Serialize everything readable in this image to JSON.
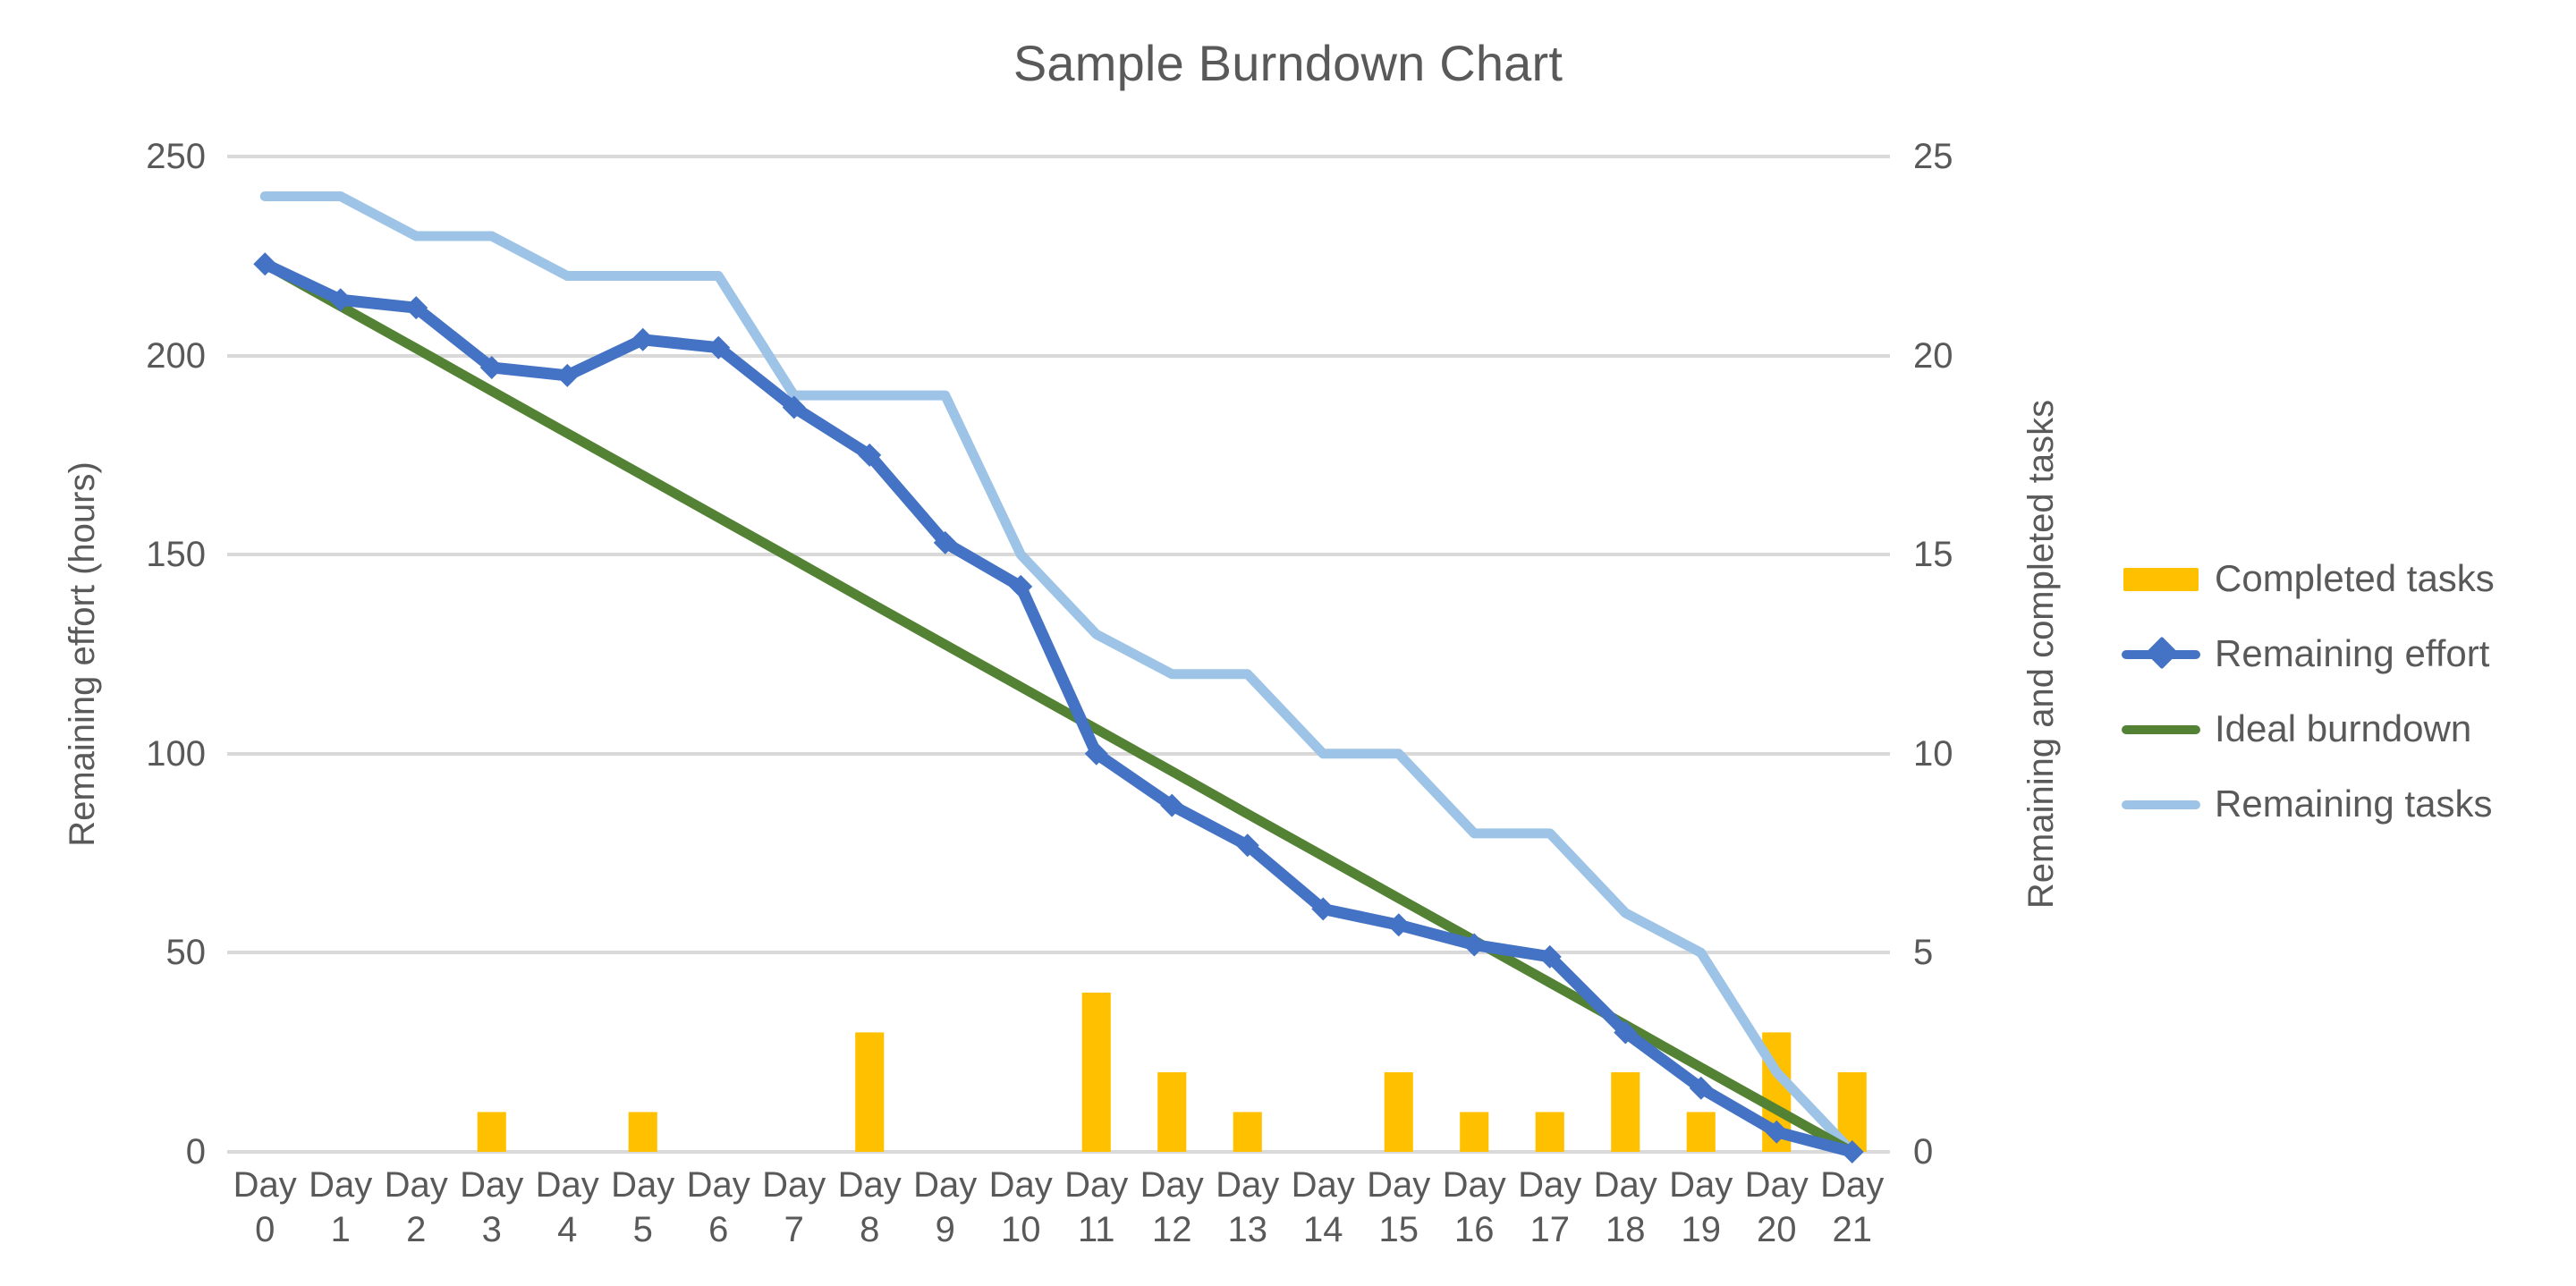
{
  "chart": {
    "title": "Sample Burndown Chart",
    "background_color": "#ffffff",
    "text_color": "#595959",
    "gridline_color": "#d9d9d9"
  },
  "axes": {
    "left": {
      "title": "Remaining effort (hours)",
      "ticks": [
        "0",
        "50",
        "100",
        "150",
        "200",
        "250"
      ],
      "min": 0,
      "max": 250
    },
    "right": {
      "title": "Remaining and completed tasks",
      "ticks": [
        "0",
        "5",
        "10",
        "15",
        "20",
        "25"
      ],
      "min": 0,
      "max": 25
    },
    "bottom": {
      "labels": [
        {
          "day": "Day",
          "num": "0"
        },
        {
          "day": "Day",
          "num": "1"
        },
        {
          "day": "Day",
          "num": "2"
        },
        {
          "day": "Day",
          "num": "3"
        },
        {
          "day": "Day",
          "num": "4"
        },
        {
          "day": "Day",
          "num": "5"
        },
        {
          "day": "Day",
          "num": "6"
        },
        {
          "day": "Day",
          "num": "7"
        },
        {
          "day": "Day",
          "num": "8"
        },
        {
          "day": "Day",
          "num": "9"
        },
        {
          "day": "Day",
          "num": "10"
        },
        {
          "day": "Day",
          "num": "11"
        },
        {
          "day": "Day",
          "num": "12"
        },
        {
          "day": "Day",
          "num": "13"
        },
        {
          "day": "Day",
          "num": "14"
        },
        {
          "day": "Day",
          "num": "15"
        },
        {
          "day": "Day",
          "num": "16"
        },
        {
          "day": "Day",
          "num": "17"
        },
        {
          "day": "Day",
          "num": "18"
        },
        {
          "day": "Day",
          "num": "19"
        },
        {
          "day": "Day",
          "num": "20"
        },
        {
          "day": "Day",
          "num": "21"
        }
      ]
    }
  },
  "legend": {
    "position": "right",
    "items": [
      {
        "label": "Completed tasks",
        "key": "bar",
        "color": "#FFC000"
      },
      {
        "label": "Remaining effort",
        "key": "line-marker",
        "color": "#4472C4"
      },
      {
        "label": "Ideal burndown",
        "key": "line",
        "color": "#548235"
      },
      {
        "label": "Remaining tasks",
        "key": "line",
        "color": "#9DC3E6"
      }
    ]
  },
  "chart_data": {
    "type": "line",
    "title": "Sample Burndown Chart",
    "xlabel": "",
    "ylabel": "Remaining effort (hours)",
    "y2label": "Remaining and completed tasks",
    "ylim": [
      0,
      250
    ],
    "y2lim": [
      0,
      25
    ],
    "grid": true,
    "legend_position": "right",
    "categories": [
      "Day 0",
      "Day 1",
      "Day 2",
      "Day 3",
      "Day 4",
      "Day 5",
      "Day 6",
      "Day 7",
      "Day 8",
      "Day 9",
      "Day 10",
      "Day 11",
      "Day 12",
      "Day 13",
      "Day 14",
      "Day 15",
      "Day 16",
      "Day 17",
      "Day 18",
      "Day 19",
      "Day 20",
      "Day 21"
    ],
    "series": [
      {
        "name": "Completed tasks",
        "type": "bar",
        "axis": "right",
        "color": "#FFC000",
        "values": [
          0,
          0,
          0,
          1,
          0,
          1,
          0,
          0,
          3,
          0,
          0,
          4,
          2,
          1,
          0,
          2,
          1,
          1,
          2,
          1,
          3,
          2
        ]
      },
      {
        "name": "Remaining effort",
        "type": "line",
        "axis": "left",
        "color": "#4472C4",
        "marker": "diamond",
        "values": [
          223,
          214,
          212,
          197,
          195,
          204,
          202,
          187,
          175,
          153,
          142,
          100,
          87,
          77,
          61,
          57,
          52,
          49,
          30,
          16,
          5,
          0
        ]
      },
      {
        "name": "Ideal burndown",
        "type": "line",
        "axis": "left",
        "color": "#548235",
        "marker": "none",
        "values": [
          223,
          212.4,
          201.8,
          191.1,
          180.5,
          169.9,
          159.3,
          148.7,
          138.0,
          127.4,
          116.8,
          106.2,
          95.6,
          84.9,
          74.3,
          63.7,
          53.1,
          42.5,
          31.9,
          21.2,
          10.6,
          0
        ]
      },
      {
        "name": "Remaining tasks",
        "type": "line",
        "axis": "right",
        "color": "#9DC3E6",
        "marker": "none",
        "values": [
          24,
          24,
          23,
          23,
          22,
          22,
          22,
          19,
          19,
          19,
          15,
          13,
          12,
          12,
          10,
          10,
          8,
          8,
          6,
          5,
          2,
          0
        ]
      }
    ]
  }
}
